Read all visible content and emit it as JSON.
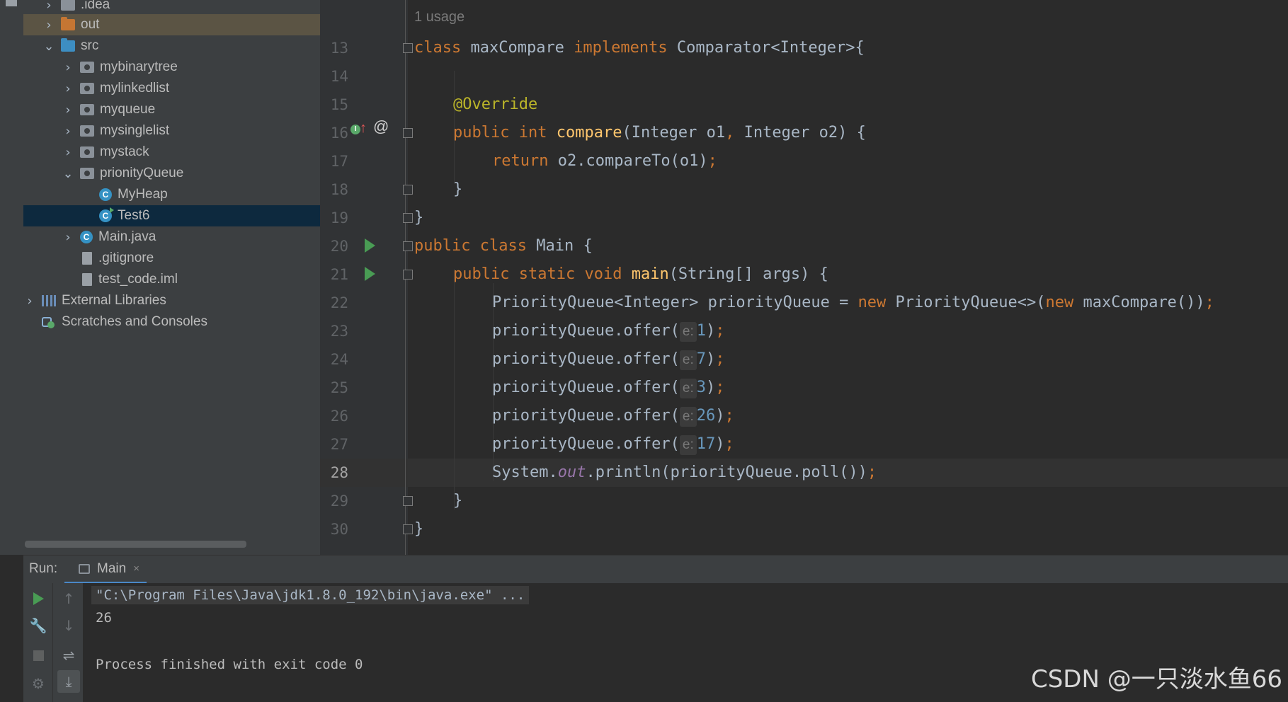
{
  "colors": {
    "keyword": "#cc7832",
    "annotation": "#bbb529",
    "method": "#ffc66d",
    "number": "#6897bb",
    "field": "#9876aa",
    "default_text": "#a9b7c6",
    "selection": "#0d293e"
  },
  "project_tree": {
    "items": [
      {
        "label": ".idea",
        "icon": "folder-icon"
      },
      {
        "label": "out",
        "icon": "folder-orange-icon"
      },
      {
        "label": "src",
        "icon": "folder-blue-icon"
      },
      {
        "label": "mybinarytree",
        "icon": "package-icon"
      },
      {
        "label": "mylinkedlist",
        "icon": "package-icon"
      },
      {
        "label": "myqueue",
        "icon": "package-icon"
      },
      {
        "label": "mysinglelist",
        "icon": "package-icon"
      },
      {
        "label": "mystack",
        "icon": "package-icon"
      },
      {
        "label": "prionityQueue",
        "icon": "package-icon"
      },
      {
        "label": "MyHeap",
        "icon": "class-icon"
      },
      {
        "label": "Test6",
        "icon": "class-runnable-icon"
      },
      {
        "label": "Main.java",
        "icon": "class-icon"
      },
      {
        "label": ".gitignore",
        "icon": "file-icon"
      },
      {
        "label": "test_code.iml",
        "icon": "file-icon"
      },
      {
        "label": "External Libraries",
        "icon": "libraries-icon"
      },
      {
        "label": "Scratches and Consoles",
        "icon": "scratches-icon"
      }
    ],
    "chevrons": {
      "collapsed": "›",
      "expanded": "⌄"
    }
  },
  "editor": {
    "usage_hint": "1 usage",
    "param_hint": "e:",
    "line_numbers": [
      "13",
      "14",
      "15",
      "16",
      "17",
      "18",
      "19",
      "20",
      "21",
      "22",
      "23",
      "24",
      "25",
      "26",
      "27",
      "28",
      "29",
      "30"
    ],
    "tokens": {
      "l13": [
        "class",
        " maxCompare ",
        "implements",
        " Comparator<Integer>{"
      ],
      "l15": [
        "@Override"
      ],
      "l16": [
        "public",
        " ",
        "int",
        " ",
        "compare",
        "(Integer o1",
        ",",
        " Integer o2) {"
      ],
      "l17": [
        "return",
        " o2.compareTo(o1)",
        ";"
      ],
      "l18": [
        "}"
      ],
      "l19": [
        "}"
      ],
      "l20": [
        "public",
        " ",
        "class",
        " Main {"
      ],
      "l21": [
        "public",
        " ",
        "static",
        " ",
        "void",
        " ",
        "main",
        "(String[] args) {"
      ],
      "l22": [
        "PriorityQueue<Integer> priorityQueue = ",
        "new",
        " PriorityQueue<>(",
        "new",
        " maxCompare())",
        ";"
      ],
      "offer_call": "priorityQueue.offer(",
      "offer_values": [
        "1",
        "7",
        "3",
        "26",
        "17"
      ],
      "close_paren": ")",
      "semicolon": ";",
      "l28": [
        "System.",
        "out",
        ".println(priorityQueue.poll())",
        ";"
      ],
      "l29": [
        "}"
      ],
      "l30": [
        "}"
      ]
    },
    "gutter_at": "@",
    "gutter_impl": "I",
    "gutter_arrow": "↑"
  },
  "run_panel": {
    "label": "Run:",
    "tab_label": "Main",
    "tab_close": "×",
    "console": {
      "command": "\"C:\\Program Files\\Java\\jdk1.8.0_192\\bin\\java.exe\" ...",
      "output": "26",
      "finished": "Process finished with exit code 0"
    },
    "tools": {
      "up": "↑",
      "down": "↓",
      "wrench": "🔧",
      "wrap": "⇌",
      "scroll_end": "⤓",
      "settings": "⚙"
    }
  },
  "watermark": "CSDN @一只淡水鱼66"
}
